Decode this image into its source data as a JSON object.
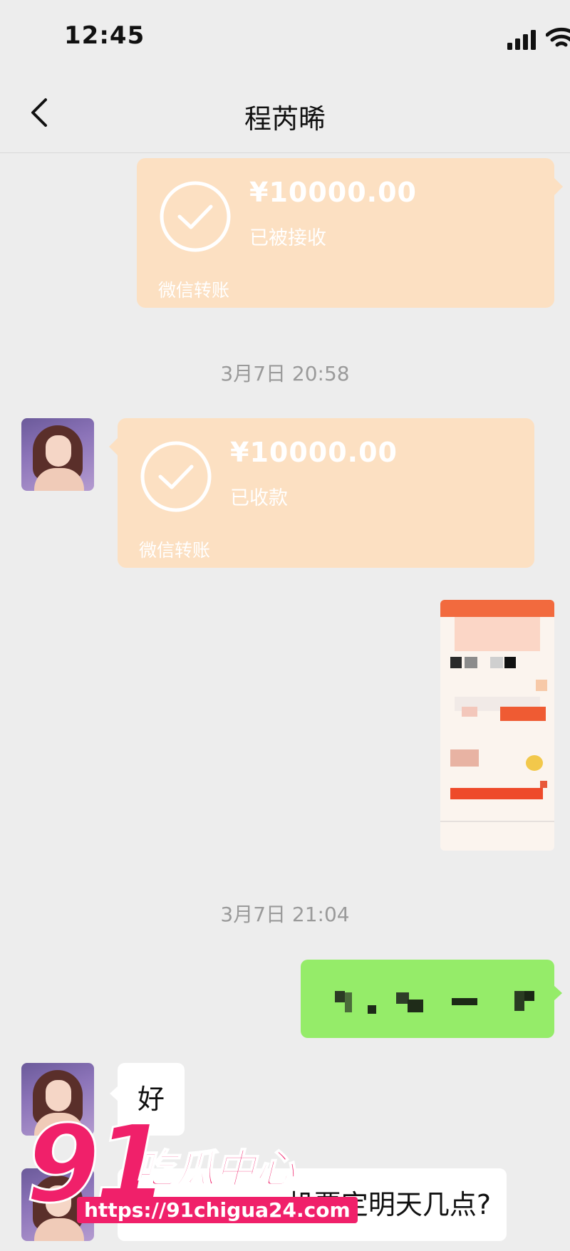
{
  "status_bar": {
    "time": "12:45",
    "icons": [
      "signal-icon",
      "wifi-icon"
    ]
  },
  "nav": {
    "back_icon": "chevron-left-icon",
    "title": "程芮晞"
  },
  "messages": {
    "transfer_1": {
      "amount": "¥10000.00",
      "status": "已被接收",
      "label": "微信转账",
      "side": "right"
    },
    "timestamp_1": "3月7日 20:58",
    "transfer_2": {
      "amount": "¥10000.00",
      "status": "已收款",
      "label": "微信转账",
      "side": "left"
    },
    "timestamp_2": "3月7日 21:04",
    "reply_1": "好",
    "reply_2": "机票定明天几点?"
  },
  "watermark": {
    "logo_number": "91",
    "logo_text": "吃瓜中心",
    "url": "https://91chigua24.com"
  },
  "colors": {
    "background": "#ededed",
    "transfer_card": "#fce0c2",
    "own_bubble": "#95ec69",
    "watermark": "#f0206a"
  }
}
